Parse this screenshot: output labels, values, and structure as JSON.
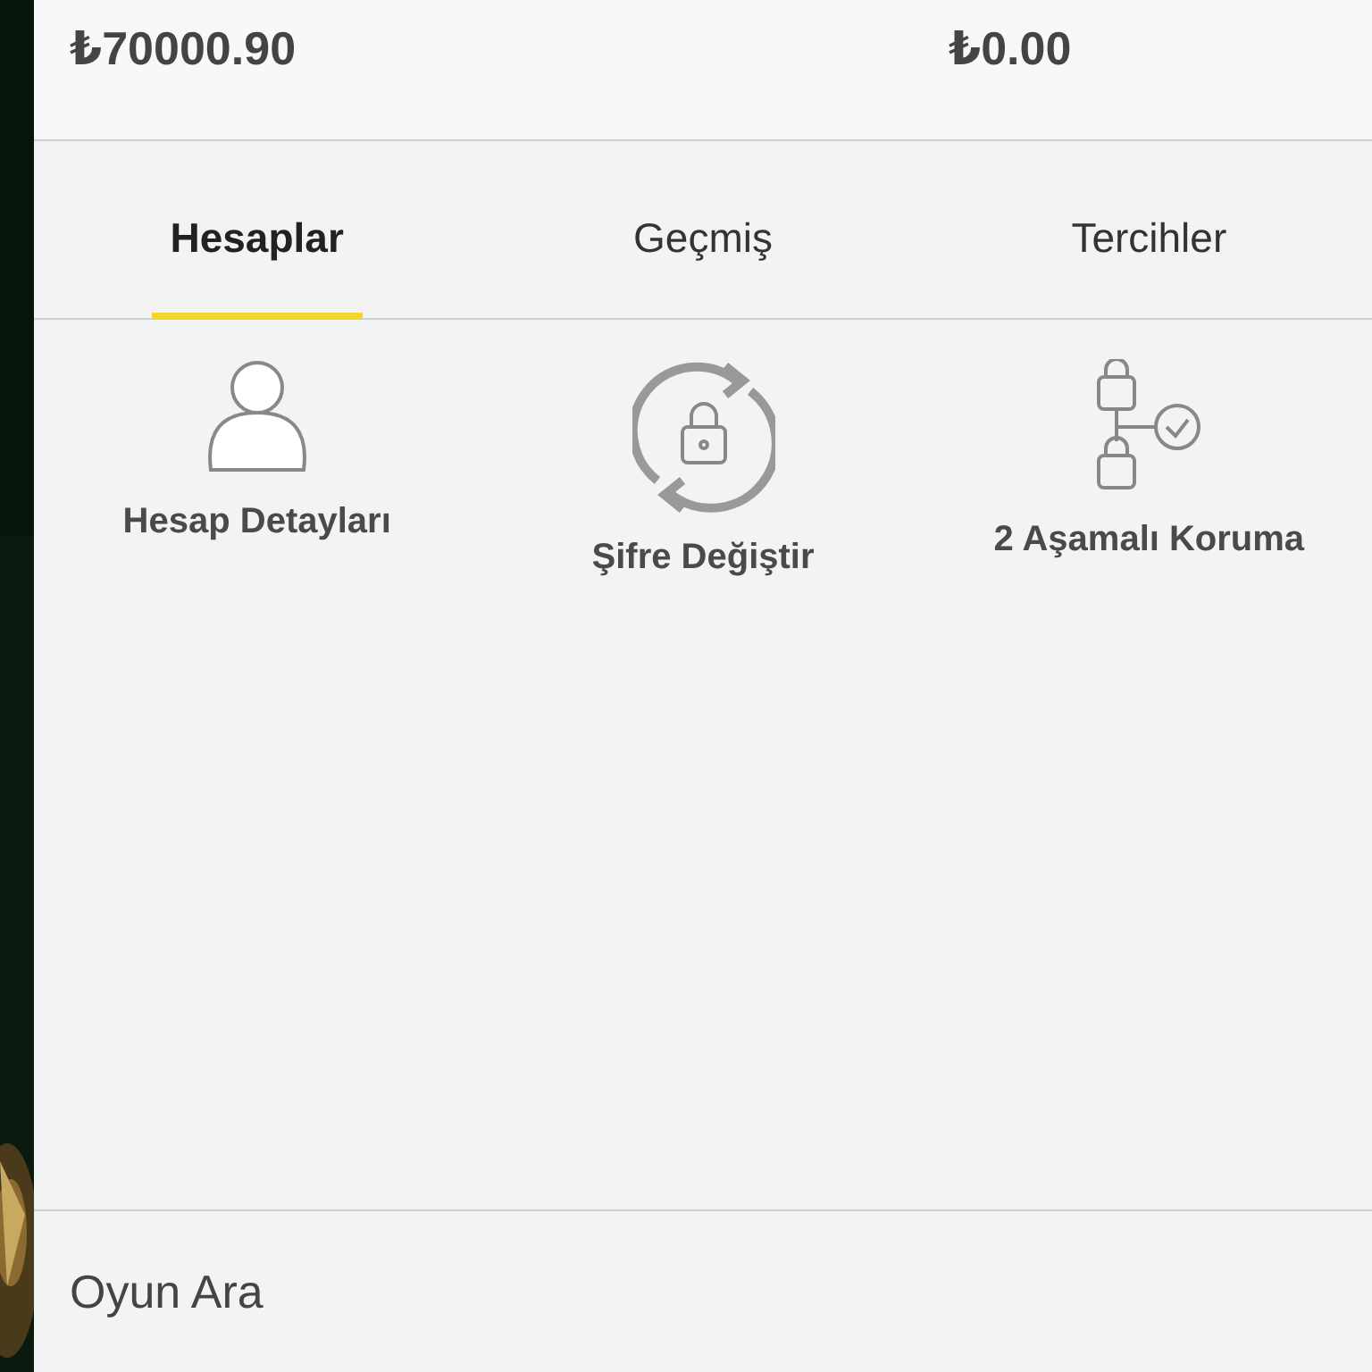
{
  "balances": [
    {
      "amount": "₺70000.90"
    },
    {
      "amount": "₺0.00"
    }
  ],
  "tabs": [
    {
      "label": "Hesaplar",
      "selected": true
    },
    {
      "label": "Geçmiş",
      "selected": false
    },
    {
      "label": "Tercihler",
      "selected": false
    }
  ],
  "actions": [
    {
      "kind": "profile",
      "label": "Hesap Detayları"
    },
    {
      "kind": "password",
      "label": "Şifre Değiştir"
    },
    {
      "kind": "twofactor",
      "label": "2 Aşamalı Koruma"
    }
  ],
  "search": {
    "label": "Oyun Ara"
  }
}
